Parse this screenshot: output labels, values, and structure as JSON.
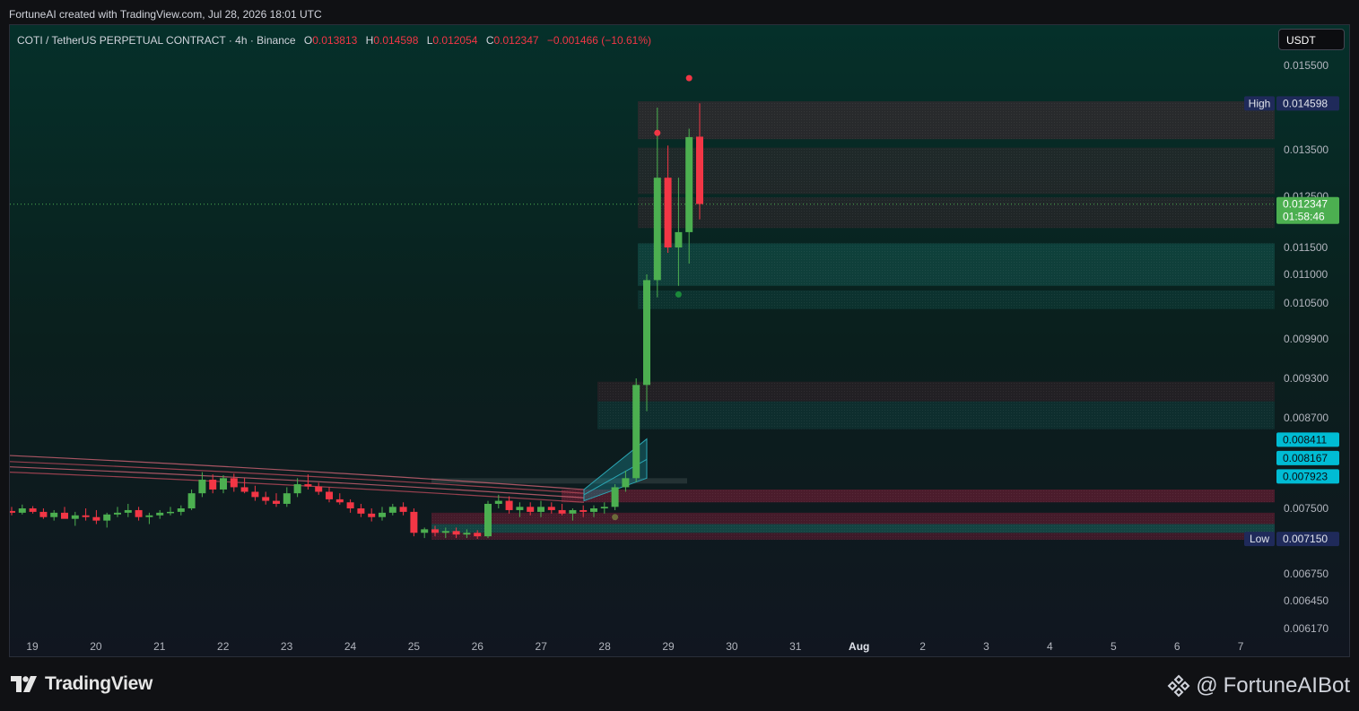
{
  "header": {
    "credit": "FortuneAI created with TradingView.com, Jul 28, 2026 18:01 UTC"
  },
  "legend": {
    "symbol": "COTI / TetherUS PERPETUAL CONTRACT · 4h · Binance",
    "o_label": "O",
    "o_value": "0.013813",
    "h_label": "H",
    "h_value": "0.014598",
    "l_label": "L",
    "l_value": "0.012054",
    "c_label": "C",
    "c_value": "0.012347",
    "change": "−0.001466 (−10.61%)"
  },
  "currency_button": "USDT",
  "footer": {
    "logo_text": "TradingView",
    "handle": "FortuneAIBot",
    "at": "@"
  },
  "colors": {
    "bull": "#4caf50",
    "bear": "#f23645",
    "bg_top": "#052b24",
    "bg_bottom": "#131722",
    "tag_high_low": "#1f2a5a",
    "tag_cyan": "#00bcd4",
    "tag_green": "#4caf50"
  },
  "chart_data": {
    "type": "candlestick",
    "timeframe": "4h",
    "y_axis": {
      "ticks": [
        "0.015500",
        "0.013500",
        "0.012500",
        "0.011500",
        "0.011000",
        "0.010500",
        "0.009900",
        "0.009300",
        "0.008700",
        "0.007500",
        "0.006750",
        "0.006450",
        "0.006170"
      ]
    },
    "x_axis": {
      "ticks": [
        "19",
        "20",
        "21",
        "22",
        "23",
        "24",
        "25",
        "26",
        "27",
        "28",
        "29",
        "30",
        "31",
        "Aug",
        "2",
        "3",
        "4",
        "5",
        "6",
        "7"
      ]
    },
    "price_tags": [
      {
        "label": "High",
        "value": "0.014598",
        "kind": "high"
      },
      {
        "label": "",
        "value": "0.012347",
        "sub": "01:58:46",
        "kind": "last"
      },
      {
        "label": "",
        "value": "0.008411",
        "kind": "cyan"
      },
      {
        "label": "",
        "value": "0.008167",
        "kind": "cyan"
      },
      {
        "label": "",
        "value": "0.007923",
        "kind": "cyan"
      },
      {
        "label": "Low",
        "value": "0.007150",
        "kind": "low"
      }
    ],
    "ohlc": [
      [
        0.00747,
        0.00752,
        0.00742,
        0.00745
      ],
      [
        0.00745,
        0.00755,
        0.00743,
        0.0075
      ],
      [
        0.0075,
        0.00753,
        0.00744,
        0.00746
      ],
      [
        0.00746,
        0.0075,
        0.00738,
        0.0074
      ],
      [
        0.0074,
        0.00748,
        0.00736,
        0.00745
      ],
      [
        0.00745,
        0.00752,
        0.0074,
        0.00738
      ],
      [
        0.00738,
        0.00746,
        0.0073,
        0.00742
      ],
      [
        0.00742,
        0.0075,
        0.00736,
        0.0074
      ],
      [
        0.0074,
        0.00748,
        0.00732,
        0.00736
      ],
      [
        0.00736,
        0.00745,
        0.00728,
        0.00743
      ],
      [
        0.00743,
        0.00752,
        0.0074,
        0.00745
      ],
      [
        0.00745,
        0.00756,
        0.0074,
        0.00748
      ],
      [
        0.00748,
        0.00752,
        0.00736,
        0.0074
      ],
      [
        0.0074,
        0.00745,
        0.00732,
        0.00742
      ],
      [
        0.00742,
        0.00748,
        0.00738,
        0.00745
      ],
      [
        0.00745,
        0.00752,
        0.00742,
        0.00746
      ],
      [
        0.00746,
        0.00754,
        0.00742,
        0.0075
      ],
      [
        0.0075,
        0.00775,
        0.00748,
        0.0077
      ],
      [
        0.0077,
        0.00798,
        0.00765,
        0.00788
      ],
      [
        0.00788,
        0.00795,
        0.0077,
        0.00775
      ],
      [
        0.00775,
        0.00794,
        0.0077,
        0.0079
      ],
      [
        0.0079,
        0.00796,
        0.00772,
        0.00778
      ],
      [
        0.00778,
        0.0079,
        0.0077,
        0.00772
      ],
      [
        0.00772,
        0.0078,
        0.0076,
        0.00765
      ],
      [
        0.00765,
        0.00772,
        0.00755,
        0.0076
      ],
      [
        0.0076,
        0.0077,
        0.00752,
        0.00756
      ],
      [
        0.00756,
        0.00778,
        0.00752,
        0.0077
      ],
      [
        0.0077,
        0.0079,
        0.00765,
        0.00782
      ],
      [
        0.00782,
        0.00795,
        0.00775,
        0.00779
      ],
      [
        0.00779,
        0.00784,
        0.00768,
        0.00772
      ],
      [
        0.00772,
        0.00778,
        0.00758,
        0.00762
      ],
      [
        0.00762,
        0.0077,
        0.00755,
        0.00758
      ],
      [
        0.00758,
        0.00762,
        0.00745,
        0.0075
      ],
      [
        0.0075,
        0.00756,
        0.0074,
        0.00744
      ],
      [
        0.00744,
        0.0075,
        0.00735,
        0.0074
      ],
      [
        0.0074,
        0.00752,
        0.00736,
        0.00745
      ],
      [
        0.00745,
        0.00756,
        0.00742,
        0.00752
      ],
      [
        0.00752,
        0.00758,
        0.00742,
        0.00746
      ],
      [
        0.00746,
        0.0075,
        0.00718,
        0.00722
      ],
      [
        0.00722,
        0.00728,
        0.00716,
        0.00726
      ],
      [
        0.00726,
        0.0073,
        0.00718,
        0.00722
      ],
      [
        0.00722,
        0.00728,
        0.00716,
        0.00724
      ],
      [
        0.00724,
        0.00728,
        0.00716,
        0.0072
      ],
      [
        0.0072,
        0.00726,
        0.00716,
        0.00722
      ],
      [
        0.00722,
        0.00725,
        0.00715,
        0.00718
      ],
      [
        0.00718,
        0.0076,
        0.00716,
        0.00756
      ],
      [
        0.00756,
        0.00768,
        0.0075,
        0.0076
      ],
      [
        0.0076,
        0.00766,
        0.00744,
        0.00748
      ],
      [
        0.00748,
        0.00758,
        0.0074,
        0.00752
      ],
      [
        0.00752,
        0.00758,
        0.00742,
        0.00746
      ],
      [
        0.00746,
        0.0076,
        0.0074,
        0.00752
      ],
      [
        0.00752,
        0.00758,
        0.00744,
        0.00748
      ],
      [
        0.00748,
        0.00756,
        0.00742,
        0.00744
      ],
      [
        0.00744,
        0.0075,
        0.00736,
        0.00748
      ],
      [
        0.00748,
        0.00754,
        0.0074,
        0.00746
      ],
      [
        0.00746,
        0.00754,
        0.0074,
        0.0075
      ],
      [
        0.0075,
        0.00758,
        0.00744,
        0.00752
      ],
      [
        0.00752,
        0.00782,
        0.00748,
        0.00778
      ],
      [
        0.00778,
        0.008,
        0.00772,
        0.0079
      ],
      [
        0.0079,
        0.0093,
        0.00785,
        0.0092
      ],
      [
        0.0092,
        0.011,
        0.0088,
        0.0109
      ],
      [
        0.0109,
        0.0145,
        0.0106,
        0.0129
      ],
      [
        0.0129,
        0.0136,
        0.0114,
        0.0115
      ],
      [
        0.0115,
        0.0129,
        0.0108,
        0.0118
      ],
      [
        0.0118,
        0.014,
        0.0112,
        0.0138
      ],
      [
        0.01381,
        0.0146,
        0.01205,
        0.01235
      ]
    ],
    "markers": [
      {
        "index": 61,
        "price": 0.0139,
        "side": "top",
        "color": "#f23645"
      },
      {
        "index": 64,
        "price": 0.0152,
        "side": "top",
        "color": "#f23645"
      },
      {
        "index": 63,
        "price": 0.01065,
        "side": "bottom",
        "color": "#1b8a3a"
      },
      {
        "index": 57,
        "price": 0.0074,
        "side": "bottom",
        "color": "#6b6b3a"
      }
    ]
  }
}
